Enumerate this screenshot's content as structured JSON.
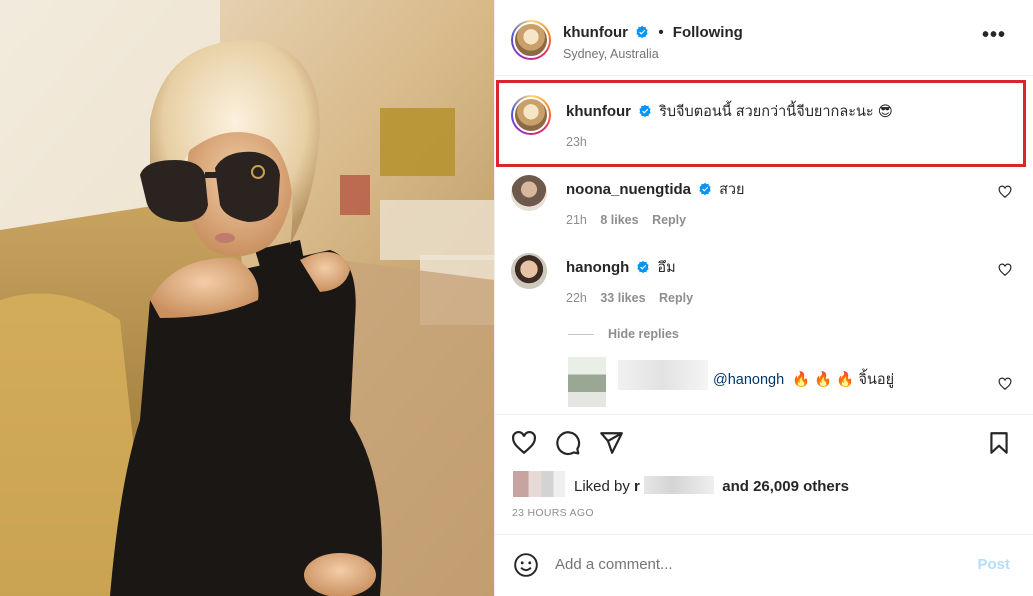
{
  "post": {
    "author": {
      "username": "khunfour",
      "verified": true,
      "follow_status": "Following",
      "location": "Sydney, Australia"
    },
    "more_icon": "more-options-icon"
  },
  "comments": [
    {
      "username": "khunfour",
      "verified": true,
      "text": "ริบจีบตอนนี้ สวยกว่านี้จีบยากละนะ 😎",
      "time": "23h"
    },
    {
      "username": "noona_nuengtida",
      "verified": true,
      "text": "สวย",
      "time": "21h",
      "likes": "8 likes",
      "reply_label": "Reply"
    },
    {
      "username": "hanongh",
      "verified": true,
      "text": "อึม",
      "time": "22h",
      "likes": "33 likes",
      "reply_label": "Reply"
    }
  ],
  "replies": {
    "toggle_label": "Hide replies",
    "items": [
      {
        "mention": "@hanongh",
        "text": "🔥 🔥 🔥 จิ้นอยู่"
      }
    ]
  },
  "actions": {
    "icons": [
      "heart-icon",
      "comment-icon",
      "share-icon",
      "save-icon"
    ]
  },
  "liked_by": {
    "prefix": "Liked by",
    "name_initial": "r",
    "suffix": "and 26,009 others"
  },
  "timestamp": "23 HOURS AGO",
  "composer": {
    "placeholder": "Add a comment...",
    "post_label": "Post"
  },
  "colors": {
    "highlight_border": "#d9262c",
    "verified": "#0095f6",
    "post_disabled": "#b2dffc",
    "mention": "#00376b"
  }
}
